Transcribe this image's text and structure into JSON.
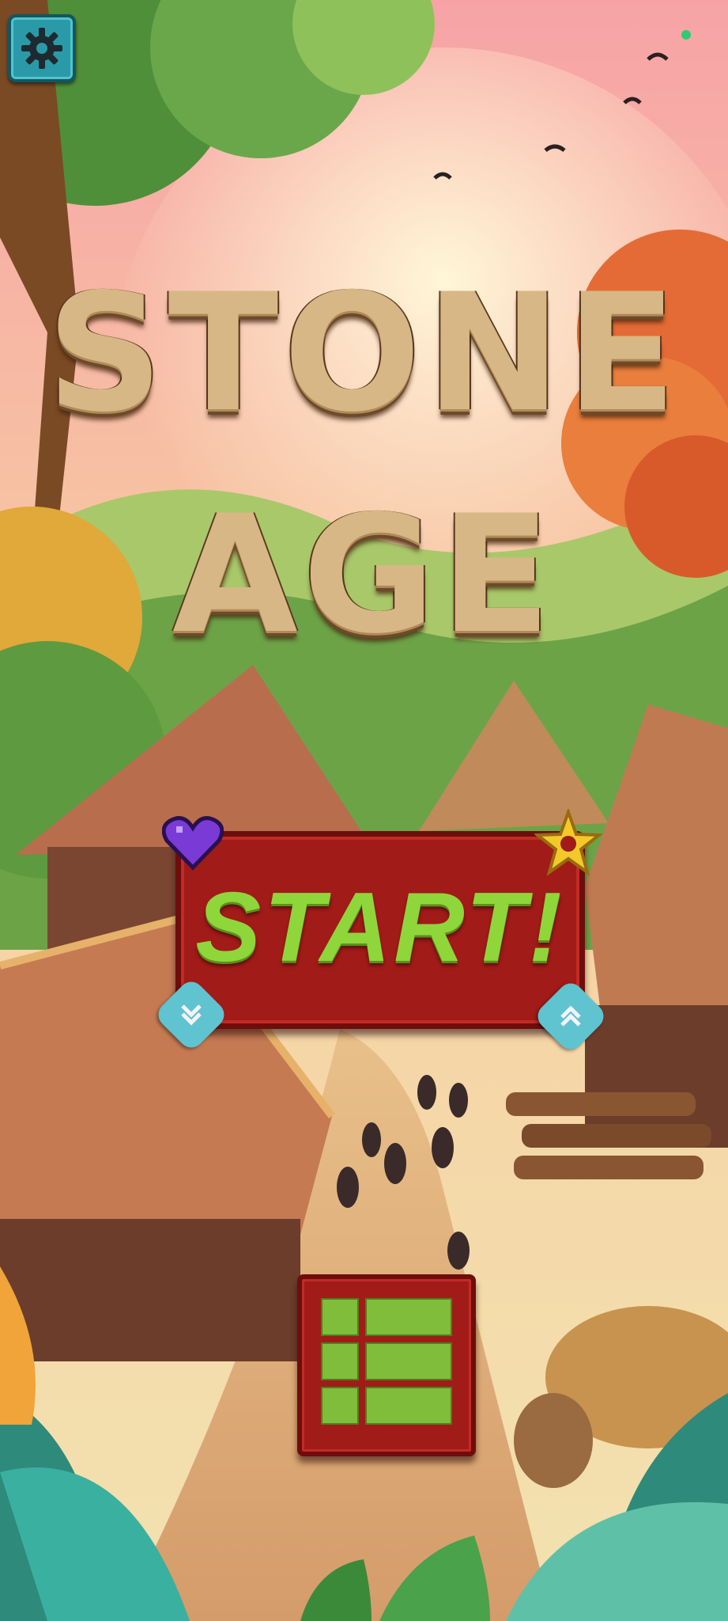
{
  "game": {
    "title_line1": "STONE",
    "title_line2": "AGE"
  },
  "buttons": {
    "start_label": "START!"
  },
  "icons": {
    "settings": "gear-icon",
    "menu": "grid-icon",
    "down": "double-chevron-down-icon",
    "up": "double-chevron-up-icon",
    "heart": "heart-icon",
    "star": "star-icon"
  },
  "colors": {
    "start_red": "#a11b18",
    "start_text_green": "#8fd63a",
    "settings_teal": "#2a9aa8",
    "status_dot": "#2ecc71"
  }
}
